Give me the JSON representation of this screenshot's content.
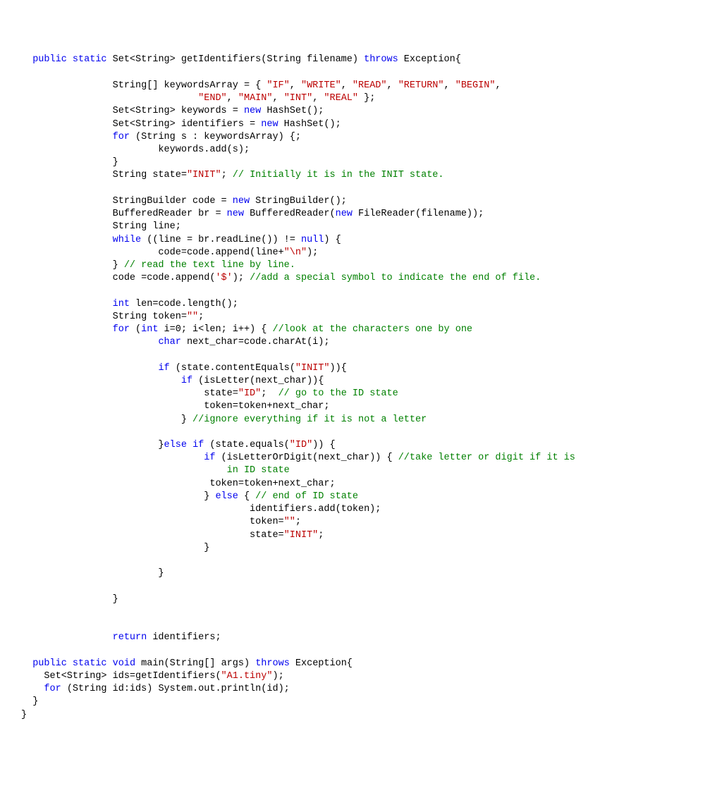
{
  "code": {
    "l1": {
      "t1": "public",
      "t2": "static",
      "t3": " Set<String> getIdentifiers(String filename) ",
      "t4": "throws",
      "t5": " Exception{"
    },
    "l2": {
      "t1": "                String[] keywordsArray = { ",
      "s1": "\"IF\"",
      "c1": ", ",
      "s2": "\"WRITE\"",
      "c2": ", ",
      "s3": "\"READ\"",
      "c3": ", ",
      "s4": "\"RETURN\"",
      "c4": ", ",
      "s5": "\"BEGIN\"",
      "c5": ","
    },
    "l3": {
      "t1": "                               ",
      "s1": "\"END\"",
      "c1": ", ",
      "s2": "\"MAIN\"",
      "c2": ", ",
      "s3": "\"INT\"",
      "c3": ", ",
      "s4": "\"REAL\"",
      "t2": " };"
    },
    "l4": {
      "t1": "                Set<String> keywords = ",
      "k1": "new",
      "t2": " HashSet();"
    },
    "l5": {
      "t1": "                Set<String> identifiers = ",
      "k1": "new",
      "t2": " HashSet();"
    },
    "l6": {
      "k1": "for",
      "t1": " (String s : keywordsArray) {;"
    },
    "l7": {
      "t1": "                        keywords.add(s);"
    },
    "l8": {
      "t1": "                }"
    },
    "l9": {
      "t1": "                String state=",
      "s1": "\"INIT\"",
      "t2": "; ",
      "c1": "// Initially it is in the INIT state."
    },
    "l10": {
      "t1": "                StringBuilder code = ",
      "k1": "new",
      "t2": " StringBuilder();"
    },
    "l11": {
      "t1": "                BufferedReader br = ",
      "k1": "new",
      "t2": " BufferedReader(",
      "k2": "new",
      "t3": " FileReader(filename));"
    },
    "l12": {
      "t1": "                String line;"
    },
    "l13": {
      "k1": "while",
      "t1": " ((line = br.readLine()) != ",
      "k2": "null",
      "t2": ") {"
    },
    "l14": {
      "t1": "                        code=code.append(line+",
      "s1": "\"\\n\"",
      "t2": ");"
    },
    "l15": {
      "t1": "                } ",
      "c1": "// read the text line by line."
    },
    "l16": {
      "t1": "                code =code.append(",
      "s1": "'$'",
      "t2": "); ",
      "c1": "//add a special symbol to indicate the end of file."
    },
    "l17": {
      "k1": "int",
      "t1": " len=code.length();"
    },
    "l18": {
      "t1": "                String token=",
      "s1": "\"\"",
      "t2": ";"
    },
    "l19": {
      "k1": "for",
      "t1": " (",
      "k2": "int",
      "t2": " i=0; i<len; i++) { ",
      "c1": "//look at the characters one by one"
    },
    "l20": {
      "k1": "char",
      "t1": " next_char=code.charAt(i);"
    },
    "l21": {
      "k1": "if",
      "t1": " (state.contentEquals(",
      "s1": "\"INIT\"",
      "t2": ")){"
    },
    "l22": {
      "k1": "if",
      "t1": " (isLetter(next_char)){"
    },
    "l23": {
      "t1": "                                state=",
      "s1": "\"ID\"",
      "t2": ";  ",
      "c1": "// go to the ID state"
    },
    "l24": {
      "t1": "                                token=token+next_char;"
    },
    "l25": {
      "t1": "                            } ",
      "c1": "//ignore everything if it is not a letter"
    },
    "l26": {
      "t1": "                        }",
      "k1": "else",
      "t2": " ",
      "k2": "if",
      "t3": " (state.equals(",
      "s1": "\"ID\"",
      "t4": ")) {"
    },
    "l27": {
      "k1": "if",
      "t1": " (isLetterOrDigit(next_char)) { ",
      "c1": "//take letter or digit if it is"
    },
    "l28": {
      "c1": "                                    in ID state"
    },
    "l29": {
      "t1": "                                 token=token+next_char;"
    },
    "l30": {
      "t1": "                                } ",
      "k1": "else",
      "t2": " { ",
      "c1": "// end of ID state"
    },
    "l31": {
      "t1": "                                        identifiers.add(token);"
    },
    "l32": {
      "t1": "                                        token=",
      "s1": "\"\"",
      "t2": ";"
    },
    "l33": {
      "t1": "                                        state=",
      "s1": "\"INIT\"",
      "t2": ";"
    },
    "l34": {
      "t1": "                                }"
    },
    "l35": {
      "t1": "                        }"
    },
    "l36": {
      "t1": "                }"
    },
    "l37": {
      "k1": "return",
      "t1": " identifiers;"
    },
    "l38": {
      "k1": "public",
      "t1": " ",
      "k2": "static",
      "t2": " ",
      "k3": "void",
      "t3": " main(String[] args) ",
      "k4": "throws",
      "t4": " Exception{"
    },
    "l39": {
      "t1": "    Set<String> ids=getIdentifiers(",
      "s1": "\"A1.tiny\"",
      "t2": ");"
    },
    "l40": {
      "k1": "for",
      "t1": " (String id:ids) System.out.println(id);"
    },
    "l41": {
      "t1": "  }"
    },
    "l42": {
      "t1": "}"
    }
  }
}
